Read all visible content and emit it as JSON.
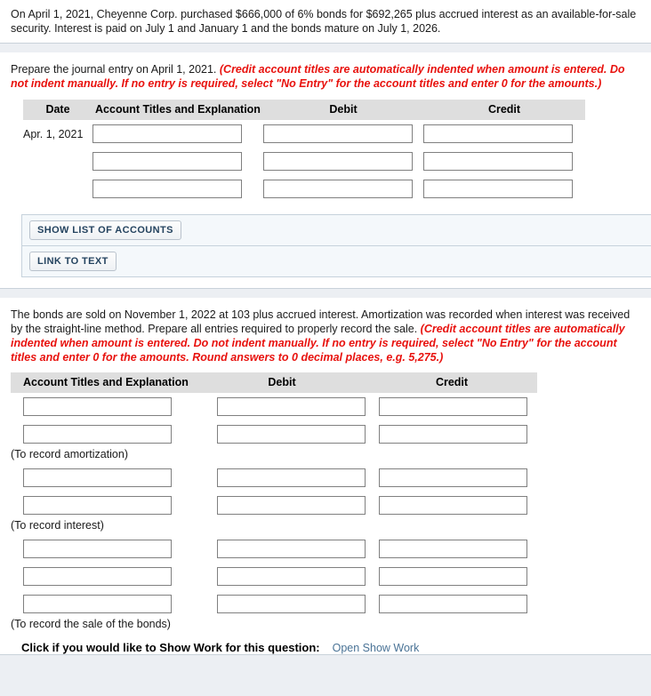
{
  "prompt": {
    "text": "On April 1, 2021, Cheyenne Corp. purchased $666,000 of 6% bonds for $692,265 plus accrued interest as an available-for-sale security. Interest is paid on July 1 and January 1 and the bonds mature on July 1, 2026."
  },
  "question1": {
    "instruction_plain": "Prepare the journal entry on April 1, 2021. ",
    "instruction_note": "(Credit account titles are automatically indented when amount is entered. Do not indent manually. If no entry is required, select \"No Entry\" for the account titles and enter 0 for the amounts.)",
    "table": {
      "columns": [
        "Date",
        "Account Titles and Explanation",
        "Debit",
        "Credit"
      ],
      "rows": [
        {
          "date": "Apr. 1, 2021",
          "account": "",
          "debit": "",
          "credit": ""
        },
        {
          "date": "",
          "account": "",
          "debit": "",
          "credit": ""
        },
        {
          "date": "",
          "account": "",
          "debit": "",
          "credit": ""
        }
      ]
    },
    "buttons": {
      "show_list_of_accounts": "SHOW LIST OF ACCOUNTS",
      "link_to_text": "LINK TO TEXT"
    }
  },
  "question2": {
    "instruction_plain": "The bonds are sold on November 1, 2022 at 103 plus accrued interest. Amortization was recorded when interest was received by the straight-line method. Prepare all entries required to properly record the sale. ",
    "instruction_note": "(Credit account titles are automatically indented when amount is entered. Do not indent manually. If no entry is required, select \"No Entry\" for the account titles and enter 0 for the amounts. Round answers to 0 decimal places, e.g. 5,275.)",
    "table": {
      "columns": [
        "Account Titles and Explanation",
        "Debit",
        "Credit"
      ],
      "groups": [
        {
          "rows": [
            {
              "account": "",
              "debit": "",
              "credit": ""
            },
            {
              "account": "",
              "debit": "",
              "credit": ""
            }
          ],
          "memo": "(To record amortization)"
        },
        {
          "rows": [
            {
              "account": "",
              "debit": "",
              "credit": ""
            },
            {
              "account": "",
              "debit": "",
              "credit": ""
            }
          ],
          "memo": "(To record interest)"
        },
        {
          "rows": [
            {
              "account": "",
              "debit": "",
              "credit": ""
            },
            {
              "account": "",
              "debit": "",
              "credit": ""
            },
            {
              "account": "",
              "debit": "",
              "credit": ""
            }
          ],
          "memo": "(To record the sale of the bonds)"
        }
      ]
    }
  },
  "show_work": {
    "label": "Click if you would like to Show Work for this question:",
    "link": "Open Show Work"
  },
  "colors": {
    "note_red": "#e8120e",
    "header_gray": "#dedede",
    "link_blue": "#4a7396",
    "button_text": "#24435f",
    "page_background": "#eceff3"
  }
}
